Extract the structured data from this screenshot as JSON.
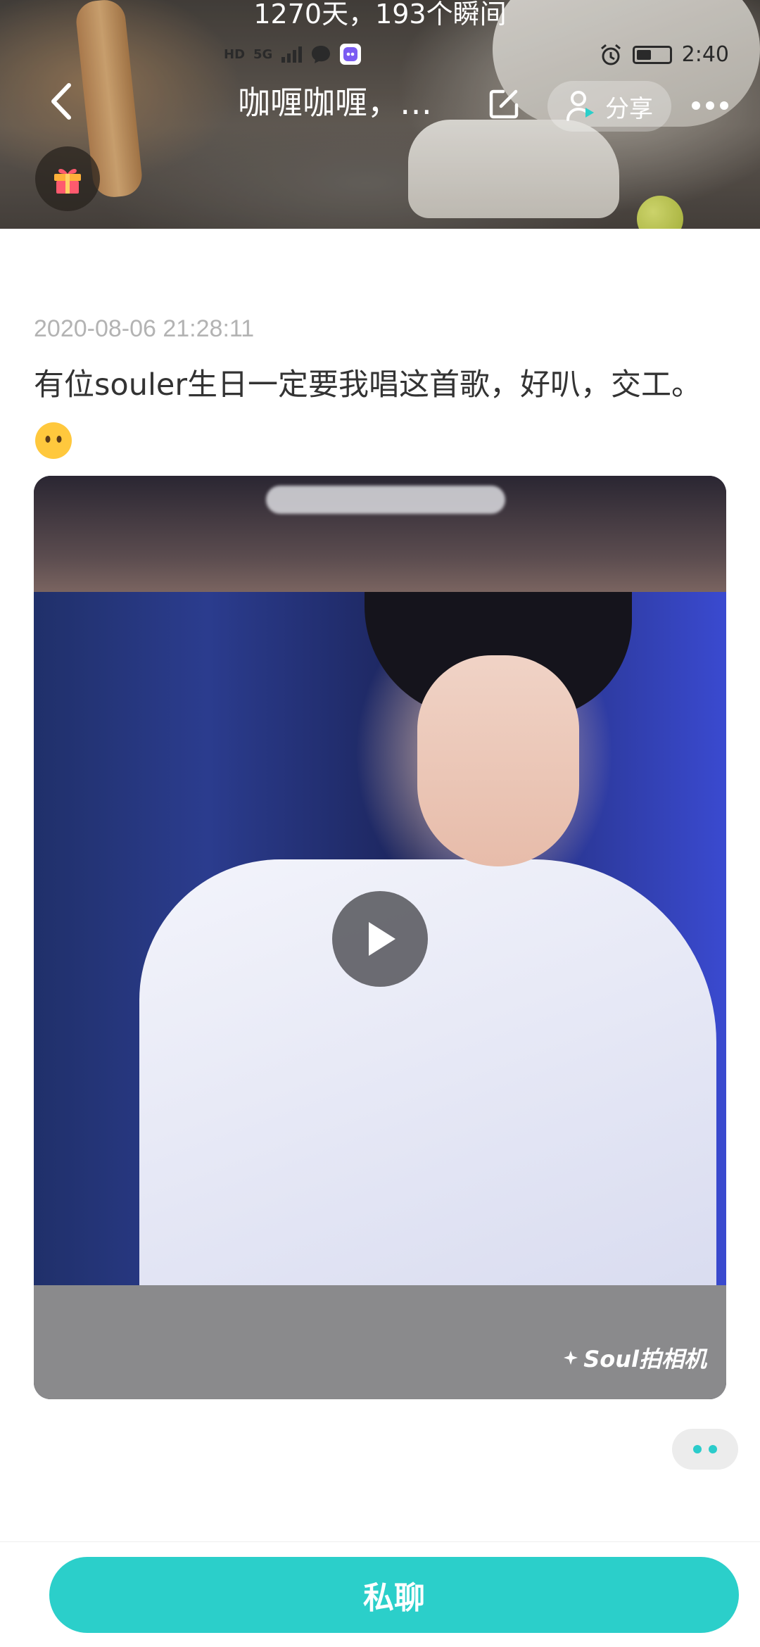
{
  "header": {
    "caption": "1270天，193个瞬间",
    "title": "咖喱咖喱，…",
    "share_label": "分享",
    "icons": {
      "back": "chevron-left-icon",
      "edit": "edit-icon",
      "share": "person-share-icon",
      "more": "more-dots-icon",
      "gift": "gift-icon"
    }
  },
  "status_bar": {
    "left_icons": [
      "HD",
      "5G",
      "signal-icon",
      "chat-bubble-icon",
      "app-icon"
    ],
    "hd": "HD",
    "net": "5G",
    "time": "2:40",
    "right_icons": [
      "alarm-icon",
      "battery-icon"
    ]
  },
  "post": {
    "timestamp": "2020-08-06 21:28:11",
    "text": "有位souler生日一定要我唱这首歌，好叭，交工。",
    "emoji": "neutral-face-emoji"
  },
  "video": {
    "watermark": "Soul拍相机",
    "play_icon": "play-icon"
  },
  "bottom": {
    "chat_label": "私聊"
  },
  "colors": {
    "accent": "#2bcfca",
    "timestamp": "#b3b3b3",
    "text": "#333333"
  }
}
